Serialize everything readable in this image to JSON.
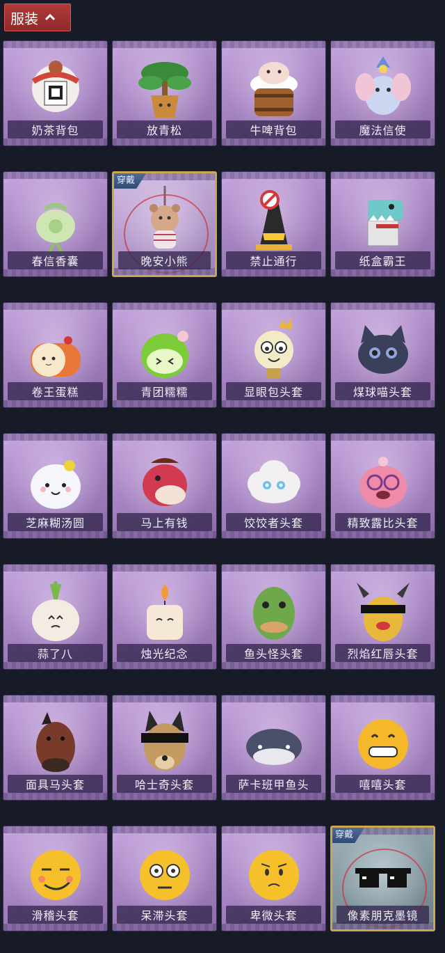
{
  "header": {
    "tab_label": "服装"
  },
  "equipped_badge": "穿戴",
  "items": [
    {
      "label": "奶茶背包",
      "icon": "milk-tea-backpack-icon",
      "equipped": false
    },
    {
      "label": "放青松",
      "icon": "pine-tree-icon",
      "equipped": false
    },
    {
      "label": "牛啤背包",
      "icon": "cow-beer-backpack-icon",
      "equipped": false
    },
    {
      "label": "魔法信使",
      "icon": "magic-elephant-icon",
      "equipped": false
    },
    {
      "label": "春信香囊",
      "icon": "sachet-icon",
      "equipped": false
    },
    {
      "label": "晚安小熊",
      "icon": "bear-keychain-icon",
      "equipped": true
    },
    {
      "label": "禁止通行",
      "icon": "no-entry-cone-icon",
      "equipped": false
    },
    {
      "label": "纸盒霸王",
      "icon": "cardboard-dino-icon",
      "equipped": false
    },
    {
      "label": "卷王蛋糕",
      "icon": "roll-cake-icon",
      "equipped": false
    },
    {
      "label": "青团糯糯",
      "icon": "green-rice-ball-icon",
      "equipped": false
    },
    {
      "label": "显眼包头套",
      "icon": "bulb-head-icon",
      "equipped": false
    },
    {
      "label": "煤球喵头套",
      "icon": "black-cat-head-icon",
      "equipped": false
    },
    {
      "label": "芝麻糊汤圆",
      "icon": "rice-dumpling-icon",
      "equipped": false
    },
    {
      "label": "马上有钱",
      "icon": "red-horse-icon",
      "equipped": false
    },
    {
      "label": "饺饺者头套",
      "icon": "dumpling-cloud-icon",
      "equipped": false
    },
    {
      "label": "精致露比头套",
      "icon": "pink-beaver-icon",
      "equipped": false
    },
    {
      "label": "蒜了八",
      "icon": "garlic-icon",
      "equipped": false
    },
    {
      "label": "烛光纪念",
      "icon": "candle-icon",
      "equipped": false
    },
    {
      "label": "鱼头怪头套",
      "icon": "fish-mask-icon",
      "equipped": false
    },
    {
      "label": "烈焰红唇头套",
      "icon": "red-lips-mask-icon",
      "equipped": false
    },
    {
      "label": "面具马头套",
      "icon": "horse-mask-icon",
      "equipped": false
    },
    {
      "label": "哈士奇头套",
      "icon": "husky-mask-icon",
      "equipped": false
    },
    {
      "label": "萨卡班甲鱼头",
      "icon": "sacabambaspis-icon",
      "equipped": false
    },
    {
      "label": "嘻嘻头套",
      "icon": "grin-emoji-icon",
      "equipped": false
    },
    {
      "label": "滑稽头套",
      "icon": "smirk-emoji-icon",
      "equipped": false
    },
    {
      "label": "呆滞头套",
      "icon": "stare-emoji-icon",
      "equipped": false
    },
    {
      "label": "卑微头套",
      "icon": "humble-emoji-icon",
      "equipped": false
    },
    {
      "label": "像素朋克墨镜",
      "icon": "pixel-sunglasses-icon",
      "equipped": true,
      "grey": true
    }
  ]
}
